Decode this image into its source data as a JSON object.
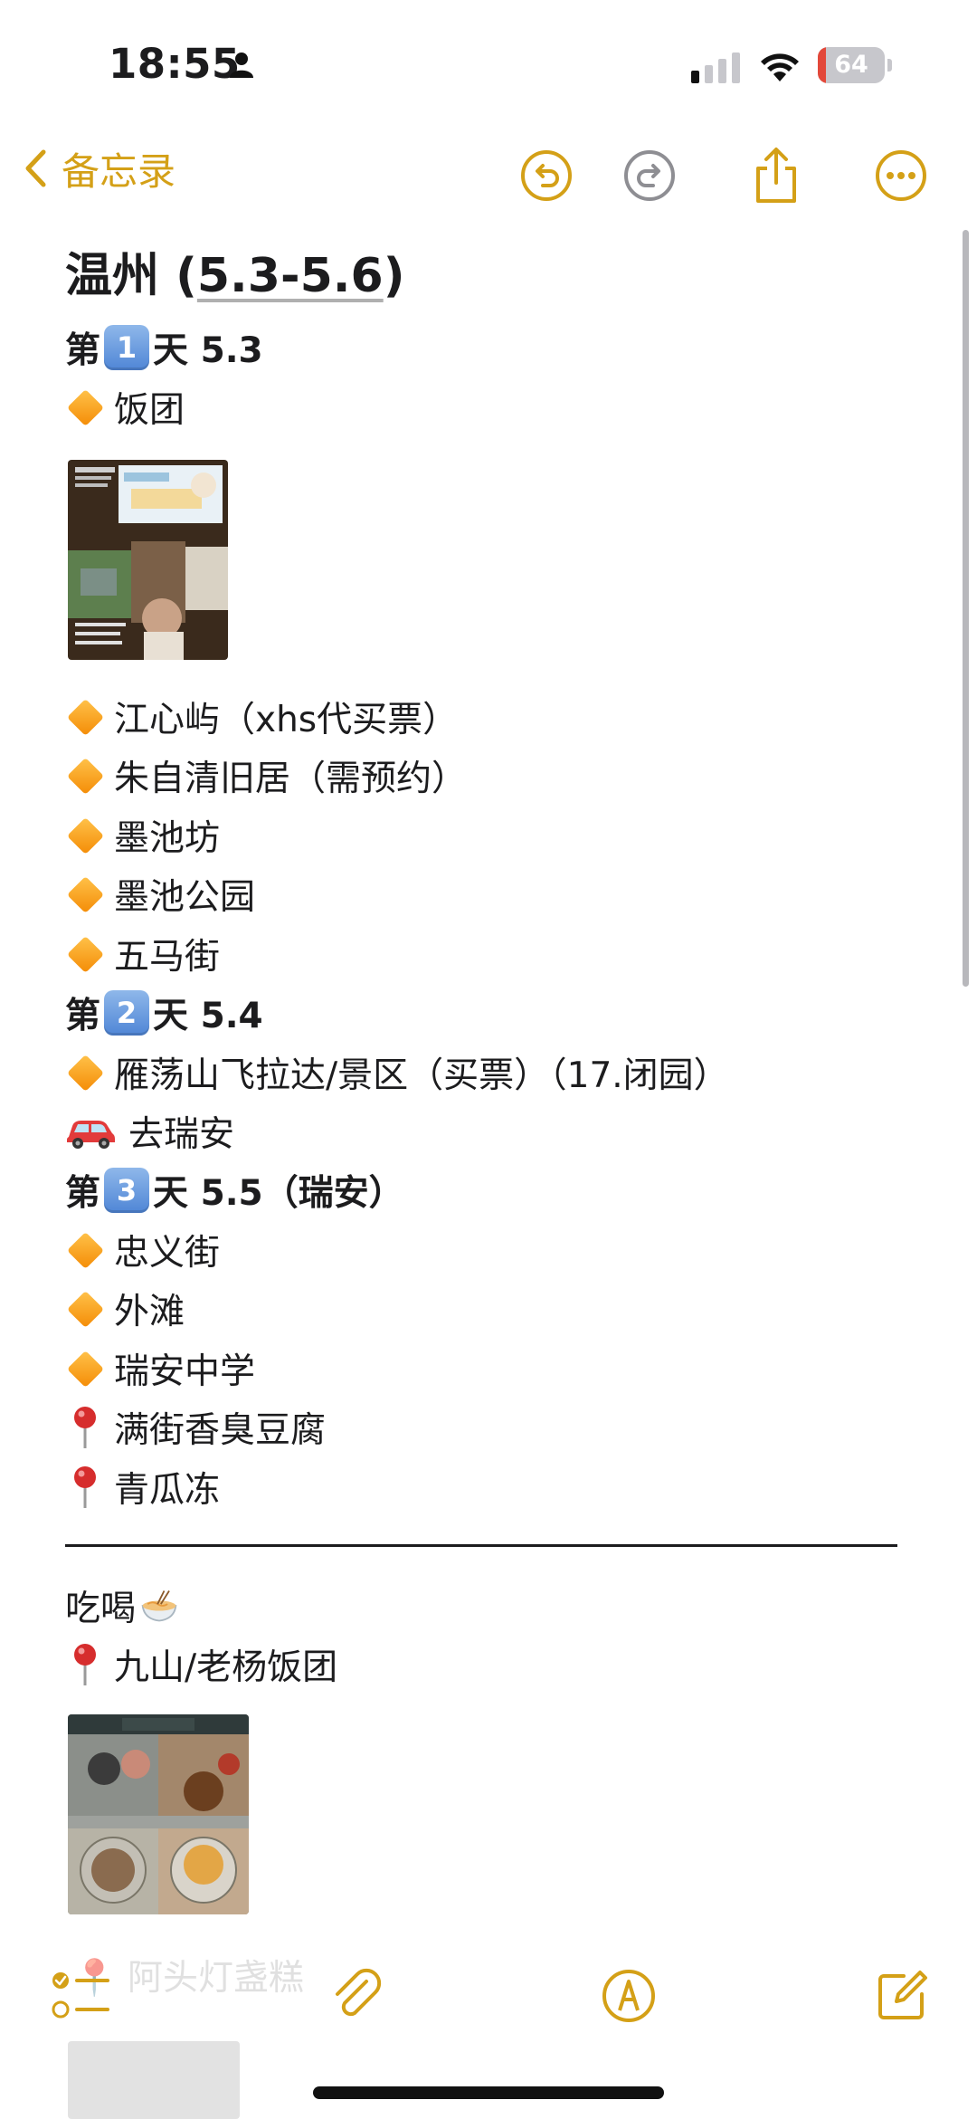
{
  "status_bar": {
    "time": "18:55",
    "battery": "64",
    "battery_level": 0.12
  },
  "nav": {
    "back_label": "备忘录",
    "icons": [
      "chevron-left-icon",
      "undo-icon",
      "redo-icon",
      "share-icon",
      "more-icon"
    ]
  },
  "note": {
    "title_prefix": "温州 (",
    "title_date": "5.3-5.6",
    "title_suffix": ")",
    "day1": {
      "prefix": "第",
      "num": "1",
      "suffix": "天 5.3"
    },
    "item_fantuan": "饭团",
    "item_jiangxinyu": "江心屿（xhs代买票）",
    "item_zhuziqing": "朱自清旧居（需预约）",
    "item_mochifang": "墨池坊",
    "item_mochi_park": "墨池公园",
    "item_wumajie": "五马街",
    "day2": {
      "prefix": "第",
      "num": "2",
      "suffix": "天 5.4"
    },
    "item_yandang": "雁荡山飞拉达/景区（买票）（17.闭园）",
    "item_ruian": "去瑞安",
    "day3": {
      "prefix": "第",
      "num": "3",
      "suffix": "天 5.5（瑞安）"
    },
    "item_zhongyi": "忠义街",
    "item_waitan": "外滩",
    "item_ruian_school": "瑞安中学",
    "item_doufu": "满街香臭豆腐",
    "item_qinggua": "青瓜冻",
    "section_food": "吃喝",
    "item_jiushan": "九山/老杨饭团"
  },
  "colors": {
    "accent": "#d4a017",
    "diamond": "#f48c06",
    "keycap": "#5b8fd8",
    "pin": "#d62d2d"
  }
}
